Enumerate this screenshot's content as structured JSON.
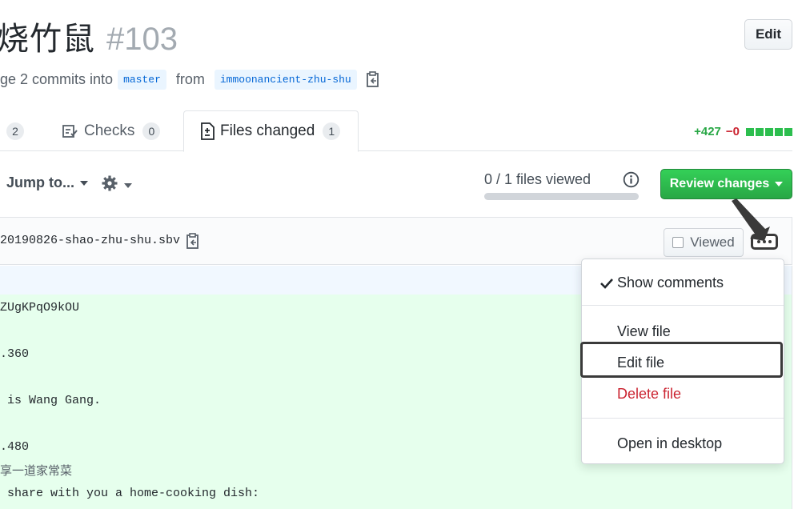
{
  "header": {
    "title": "烧竹鼠",
    "number": "#103",
    "edit_label": "Edit",
    "merge_text": "ge 2 commits into",
    "base_branch": "master",
    "from_word": "from",
    "head_branch": "immoonancient-zhu-shu"
  },
  "tabs": [
    {
      "label": "",
      "count": "2"
    },
    {
      "label": "Checks",
      "count": "0"
    },
    {
      "label": "Files changed",
      "count": "1"
    }
  ],
  "diffstat": {
    "additions": "+427",
    "deletions": "−0",
    "blocks": 5
  },
  "toolbar": {
    "jump_label": "Jump to...",
    "files_viewed": "0 / 1 files viewed",
    "files_viewed_fraction": 0,
    "review_label": "Review changes"
  },
  "file": {
    "name": "20190826-shao-zhu-shu.sbv",
    "viewed_label": "Viewed"
  },
  "diff_lines": [
    "ZUgKPqO9kOU",
    ".360",
    " is Wang Gang.",
    ".480",
    "享一道家常菜",
    " share with you a home-cooking dish:"
  ],
  "menu": {
    "show_comments": "Show comments",
    "view_file": "View file",
    "edit_file": "Edit file",
    "delete_file": "Delete file",
    "open_desktop": "Open in desktop"
  },
  "colors": {
    "accent_green": "#28a745",
    "danger_red": "#cb2431",
    "link_blue": "#0366d6",
    "addition_bg": "#e6ffed"
  }
}
